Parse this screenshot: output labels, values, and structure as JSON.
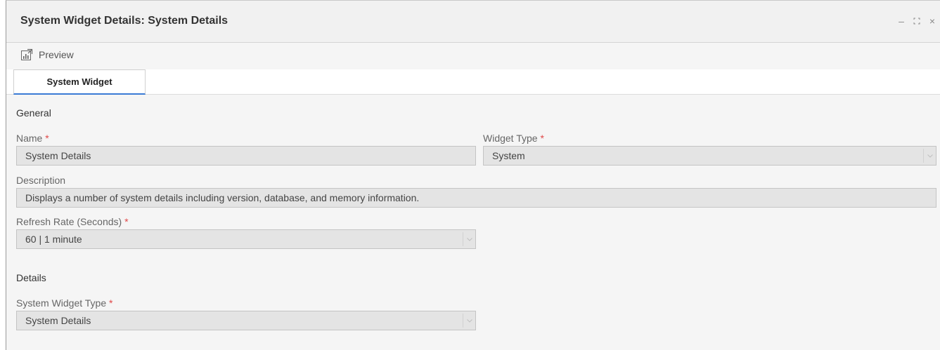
{
  "window": {
    "title": "System Widget Details: System Details",
    "controls": {
      "minimize": "–",
      "maximize": "⛶",
      "close": "×"
    }
  },
  "toolbar": {
    "preview_label": "Preview",
    "preview_icon": "chart-export-icon"
  },
  "tabs": [
    {
      "label": "System Widget",
      "active": true
    }
  ],
  "general": {
    "section_title": "General",
    "name": {
      "label": "Name",
      "value": "System Details",
      "required": "*"
    },
    "widget_type": {
      "label": "Widget Type",
      "value": "System",
      "required": "*"
    },
    "description": {
      "label": "Description",
      "value": "Displays a number of system details including version, database, and memory information."
    },
    "refresh_rate": {
      "label": "Refresh Rate (Seconds)",
      "value": "60 | 1 minute",
      "required": "*"
    }
  },
  "details": {
    "section_title": "Details",
    "system_widget_type": {
      "label": "System Widget Type",
      "value": "System Details",
      "required": "*"
    }
  },
  "colors": {
    "required": "#e04848",
    "tab_accent": "#3a7bd5",
    "field_bg": "#e4e4e4"
  }
}
